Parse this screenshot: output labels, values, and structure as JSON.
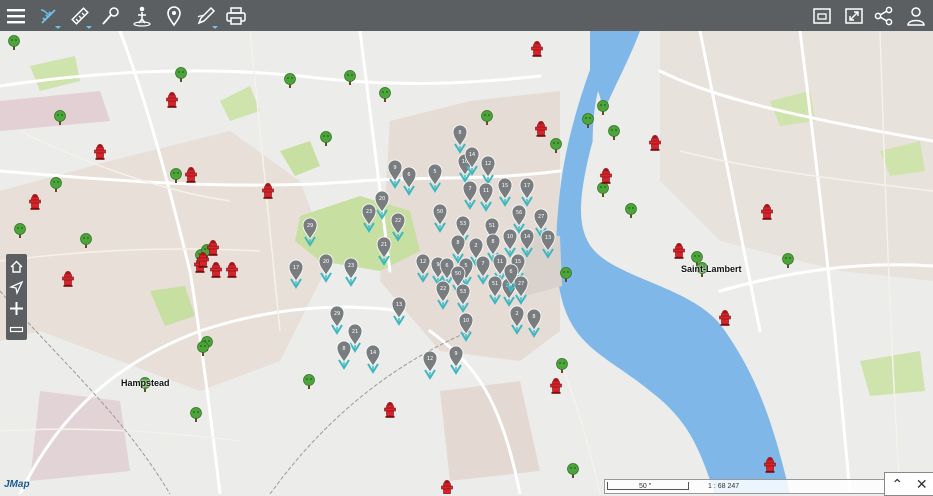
{
  "toolbar": {
    "left_tools": [
      {
        "icon": "menu-icon"
      },
      {
        "icon": "measure-tool-icon",
        "active": true
      },
      {
        "icon": "ruler-icon"
      },
      {
        "icon": "pushpin-icon"
      },
      {
        "icon": "person-location-icon"
      },
      {
        "icon": "map-pin-icon"
      },
      {
        "icon": "draw-pencil-icon"
      },
      {
        "icon": "printer-icon"
      }
    ],
    "right_tools": [
      {
        "icon": "window-icon"
      },
      {
        "icon": "fullscreen-icon"
      },
      {
        "icon": "share-icon"
      },
      {
        "icon": "user-icon"
      }
    ],
    "colors": {
      "bar": "#5b5f61",
      "accent": "#6cc3f0"
    }
  },
  "zoom_controls": {
    "items": [
      "home-icon",
      "locate-arrow-icon",
      "zoom-in-icon",
      "zoom-out-icon"
    ]
  },
  "map": {
    "place_labels": [
      "Hampstead",
      "Saint-Lambert"
    ],
    "logo": "JMap",
    "colors": {
      "water": "#7fb8e8",
      "land": "#ececea",
      "urban": "#e4dcd4",
      "park": "#c8dfa2",
      "road": "#ffffff",
      "cluster_marker": "#7a7d7f",
      "cluster_stem": "#3fb7c0",
      "tree": "#4ca53a",
      "hydrant": "#d8232a"
    },
    "marker_counts": [
      "8",
      "10",
      "14",
      "12",
      "9",
      "6",
      "5",
      "7",
      "11",
      "15",
      "17",
      "20",
      "23",
      "22",
      "50",
      "53",
      "51",
      "56",
      "27",
      "13",
      "29",
      "21",
      "8",
      "2"
    ]
  },
  "scale": {
    "distance": "50 \"",
    "ratio": "1 : 68 247"
  },
  "corner": {
    "expand": "⌃",
    "close": "✕"
  }
}
